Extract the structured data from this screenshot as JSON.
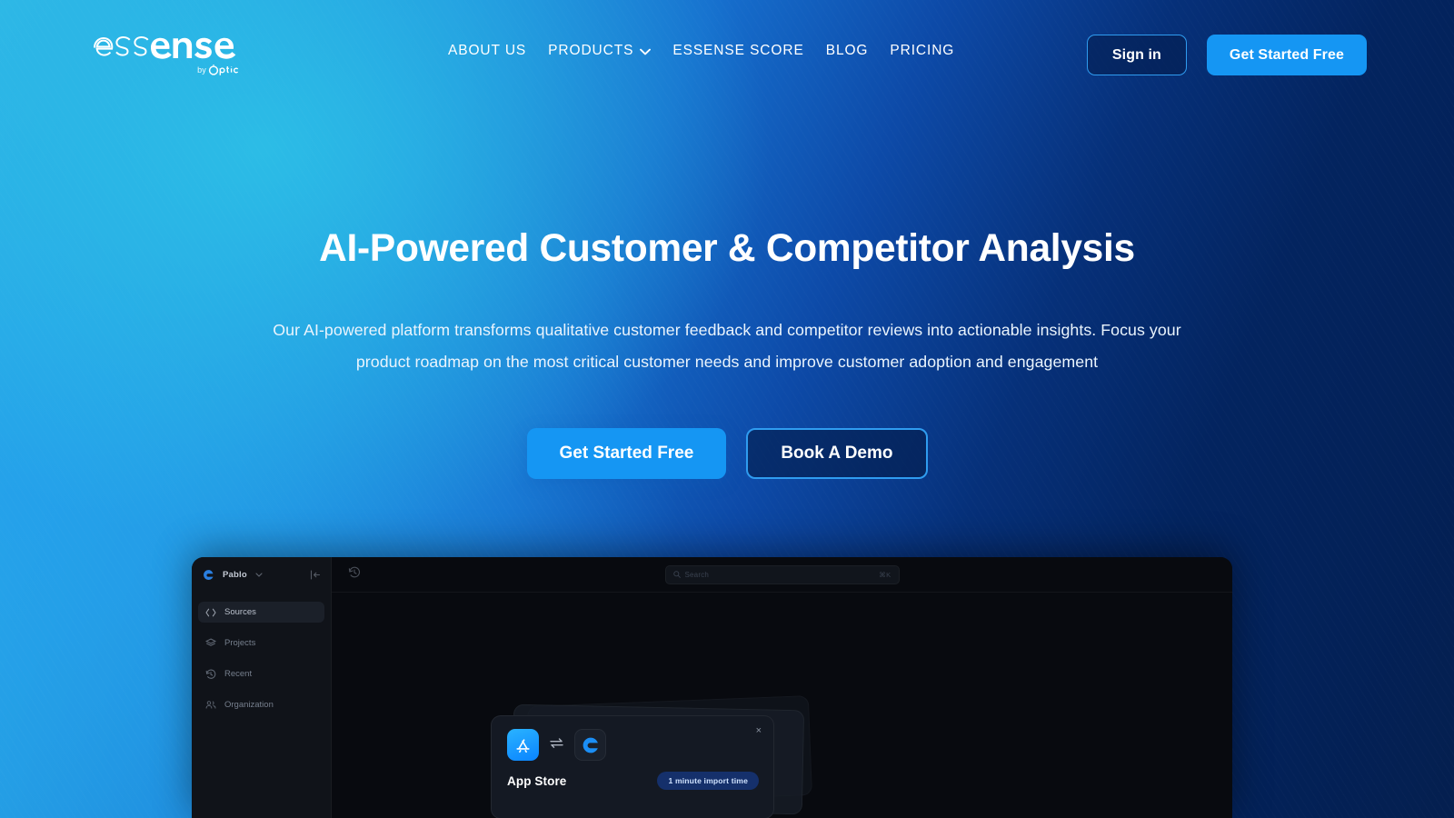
{
  "brand": {
    "logo_text": "essense",
    "logo_sub_by": "by",
    "logo_sub_name": "optic",
    "accent_blue": "#1596f3",
    "accent_border": "#2f9cf0",
    "bg_left": "#2fb6e6",
    "bg_right": "#041f4f"
  },
  "header": {
    "nav": [
      {
        "label": "ABOUT US",
        "has_dropdown": false
      },
      {
        "label": "PRODUCTS",
        "has_dropdown": true
      },
      {
        "label": "ESSENSE SCORE",
        "has_dropdown": false
      },
      {
        "label": "BLOG",
        "has_dropdown": false
      },
      {
        "label": "PRICING",
        "has_dropdown": false
      }
    ],
    "sign_in_label": "Sign in",
    "get_started_label": "Get Started Free"
  },
  "hero": {
    "title": "AI-Powered Customer & Competitor Analysis",
    "subtitle": "Our AI-powered platform transforms qualitative customer feedback and competitor reviews into actionable insights. Focus your product roadmap on the most critical customer needs and improve customer adoption and engagement",
    "primary_cta": "Get Started Free",
    "secondary_cta": "Book A Demo"
  },
  "app_mockup": {
    "sidebar": {
      "workspace": "Pablo",
      "items": [
        {
          "label": "Sources",
          "icon": "code-brackets-icon",
          "active": true
        },
        {
          "label": "Projects",
          "icon": "layers-icon",
          "active": false
        },
        {
          "label": "Recent",
          "icon": "clock-history-icon",
          "active": false
        },
        {
          "label": "Organization",
          "icon": "people-icon",
          "active": false
        }
      ]
    },
    "topbar": {
      "search_placeholder": "Search",
      "search_shortcut": "⌘K"
    },
    "import_modal": {
      "source_name": "App Store",
      "badge": "1 minute import time",
      "close_label": "×",
      "source_icon": "app-store-icon",
      "target_icon": "essense-e-icon",
      "transfer_icon": "swap-arrows-icon"
    }
  }
}
